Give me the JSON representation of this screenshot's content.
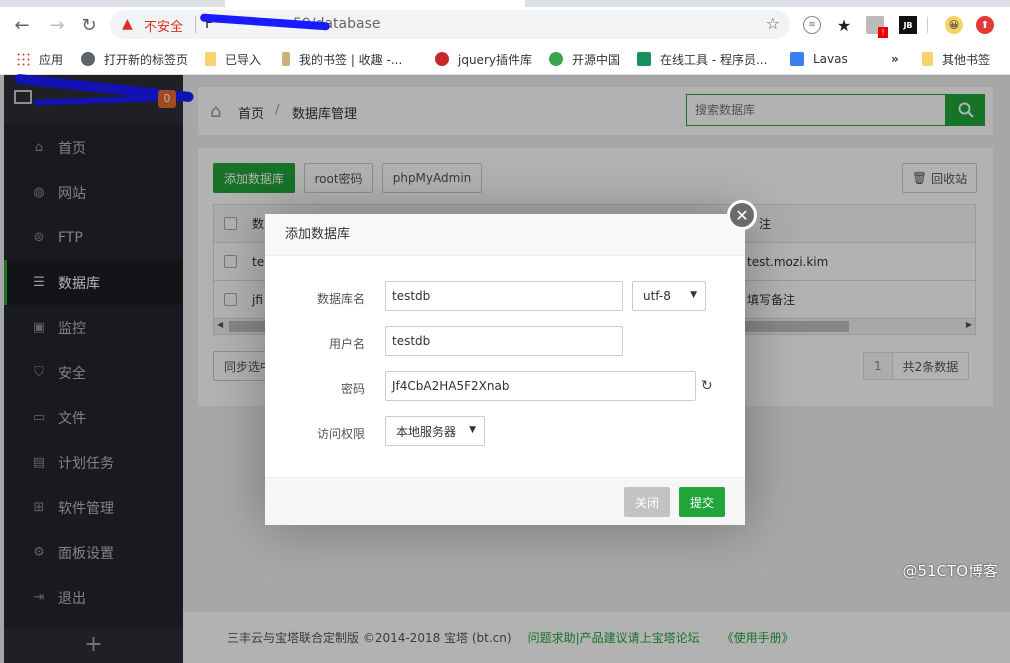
{
  "browser": {
    "insecure_label": "不安全",
    "url_visible_suffix": "59/database",
    "bookmarks": [
      {
        "label": "应用",
        "icon": "apps-grid-icon"
      },
      {
        "label": "打开新的标签页",
        "icon": "globe-icon"
      },
      {
        "label": "已导入",
        "icon": "folder-icon"
      },
      {
        "label": "我的书签 | 收趣 -...",
        "icon": "bookmark-icon"
      },
      {
        "label": "jquery插件库",
        "icon": "jquery-icon"
      },
      {
        "label": "开源中国",
        "icon": "oschina-icon"
      },
      {
        "label": "在线工具 - 程序员...",
        "icon": "tool-icon"
      },
      {
        "label": "Lavas",
        "icon": "lavas-icon"
      }
    ],
    "overflow_label": "»",
    "other_bookmarks_label": "其他书签",
    "extensions": [
      "ext-circle-icon",
      "ext-star-icon",
      "ext-alert-icon",
      "jetbrains-icon",
      "avatar-emoji-icon",
      "upload-red-icon"
    ]
  },
  "sidebar": {
    "badge_count": "0",
    "items": [
      {
        "label": "首页",
        "icon": "home-icon",
        "active": false
      },
      {
        "label": "网站",
        "icon": "globe-icon",
        "active": false
      },
      {
        "label": "FTP",
        "icon": "ftp-icon",
        "active": false
      },
      {
        "label": "数据库",
        "icon": "database-icon",
        "active": true
      },
      {
        "label": "监控",
        "icon": "monitor-chart-icon",
        "active": false
      },
      {
        "label": "安全",
        "icon": "shield-icon",
        "active": false
      },
      {
        "label": "文件",
        "icon": "folder-icon",
        "active": false
      },
      {
        "label": "计划任务",
        "icon": "calendar-icon",
        "active": false
      },
      {
        "label": "软件管理",
        "icon": "apps-icon",
        "active": false
      },
      {
        "label": "面板设置",
        "icon": "gear-icon",
        "active": false
      },
      {
        "label": "退出",
        "icon": "logout-icon",
        "active": false
      }
    ],
    "add_label": "+"
  },
  "breadcrumb": {
    "home": "首页",
    "separator": "/",
    "current": "数据库管理"
  },
  "search": {
    "placeholder": "搜索数据库"
  },
  "toolbar": {
    "add_db": "添加数据库",
    "root_password": "root密码",
    "phpmyadmin": "phpMyAdmin",
    "recycle": "回收站"
  },
  "table": {
    "header_partial": "数",
    "header_note_partial": "注",
    "rows": [
      {
        "name_partial": "te",
        "note": "test.mozi.kim"
      },
      {
        "name_partial": "jfi",
        "note": "填写备注"
      }
    ]
  },
  "bulk": {
    "sync_label_partial": "同步选中"
  },
  "pager": {
    "current_page": "1",
    "total": "共2条数据"
  },
  "footer": {
    "copyright": "三丰云与宝塔联合定制版 ©2014-2018 宝塔 (bt.cn)",
    "forum_link": "问题求助|产品建议请上宝塔论坛",
    "manual_link": "《使用手册》"
  },
  "watermark": "@51CTO博客",
  "modal": {
    "title": "添加数据库",
    "fields": {
      "db_name_label": "数据库名",
      "db_name_value": "testdb",
      "charset_value": "utf-8",
      "username_label": "用户名",
      "username_value": "testdb",
      "password_label": "密码",
      "password_value": "Jf4CbA2HA5F2Xnab",
      "access_label": "访问权限",
      "access_value": "本地服务器"
    },
    "close_label": "关闭",
    "submit_label": "提交"
  },
  "colors": {
    "brand_green": "#20a53a",
    "sidebar_bg": "#23262e",
    "badge_orange": "#e9692c",
    "insecure_red": "#d93025"
  }
}
